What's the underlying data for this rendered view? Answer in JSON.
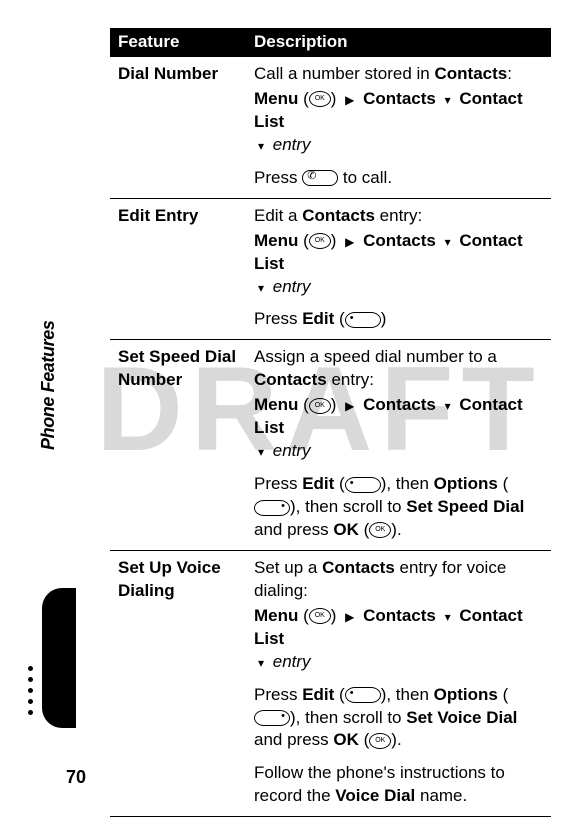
{
  "watermark": "DRAFT",
  "header": {
    "feature": "Feature",
    "description": "Description"
  },
  "rows": [
    {
      "feature": "Dial Number",
      "lead1": "Call a number stored in ",
      "lead_bold": "Contacts",
      "lead_tail": ":",
      "menu": "Menu",
      "contacts": "Contacts",
      "contactlist": "Contact List",
      "entry": "entry",
      "press_pre": "Press ",
      "press_post": " to call."
    },
    {
      "feature": "Edit Entry",
      "lead1": "Edit a ",
      "lead_bold": "Contacts",
      "lead_tail": " entry:",
      "menu": "Menu",
      "contacts": "Contacts",
      "contactlist": "Contact List",
      "entry": "entry",
      "press_pre": "Press ",
      "edit": "Edit",
      "press_post": ""
    },
    {
      "feature": "Set Speed Dial Number",
      "lead1": "Assign a speed dial number to a ",
      "lead_bold": "Contacts",
      "lead_tail": " entry:",
      "menu": "Menu",
      "contacts": "Contacts",
      "contactlist": "Contact List",
      "entry": "entry",
      "press_pre": "Press ",
      "edit": "Edit",
      "then1": ", then ",
      "options": "Options",
      "then2": ", then scroll to ",
      "target": "Set Speed Dial",
      "then3": " and press ",
      "ok": "OK",
      "tail": "."
    },
    {
      "feature": "Set Up Voice Dialing",
      "lead1": "Set up a ",
      "lead_bold": "Contacts",
      "lead_tail": " entry for voice dialing:",
      "menu": "Menu",
      "contacts": "Contacts",
      "contactlist": "Contact List",
      "entry": "entry",
      "press_pre": "Press ",
      "edit": "Edit",
      "then1": ", then ",
      "options": "Options",
      "then2": ", then scroll to ",
      "target": "Set Voice Dial",
      "then3": " and press ",
      "ok": "OK",
      "tail": ".",
      "follow1": "Follow the phone's instructions to record the ",
      "follow_bold": "Voice Dial",
      "follow2": " name."
    }
  ],
  "sidelabel": "Phone Features",
  "pagenum": "70",
  "glyphs": {
    "right": "▶",
    "down": "▾",
    "downsm": "▾"
  }
}
